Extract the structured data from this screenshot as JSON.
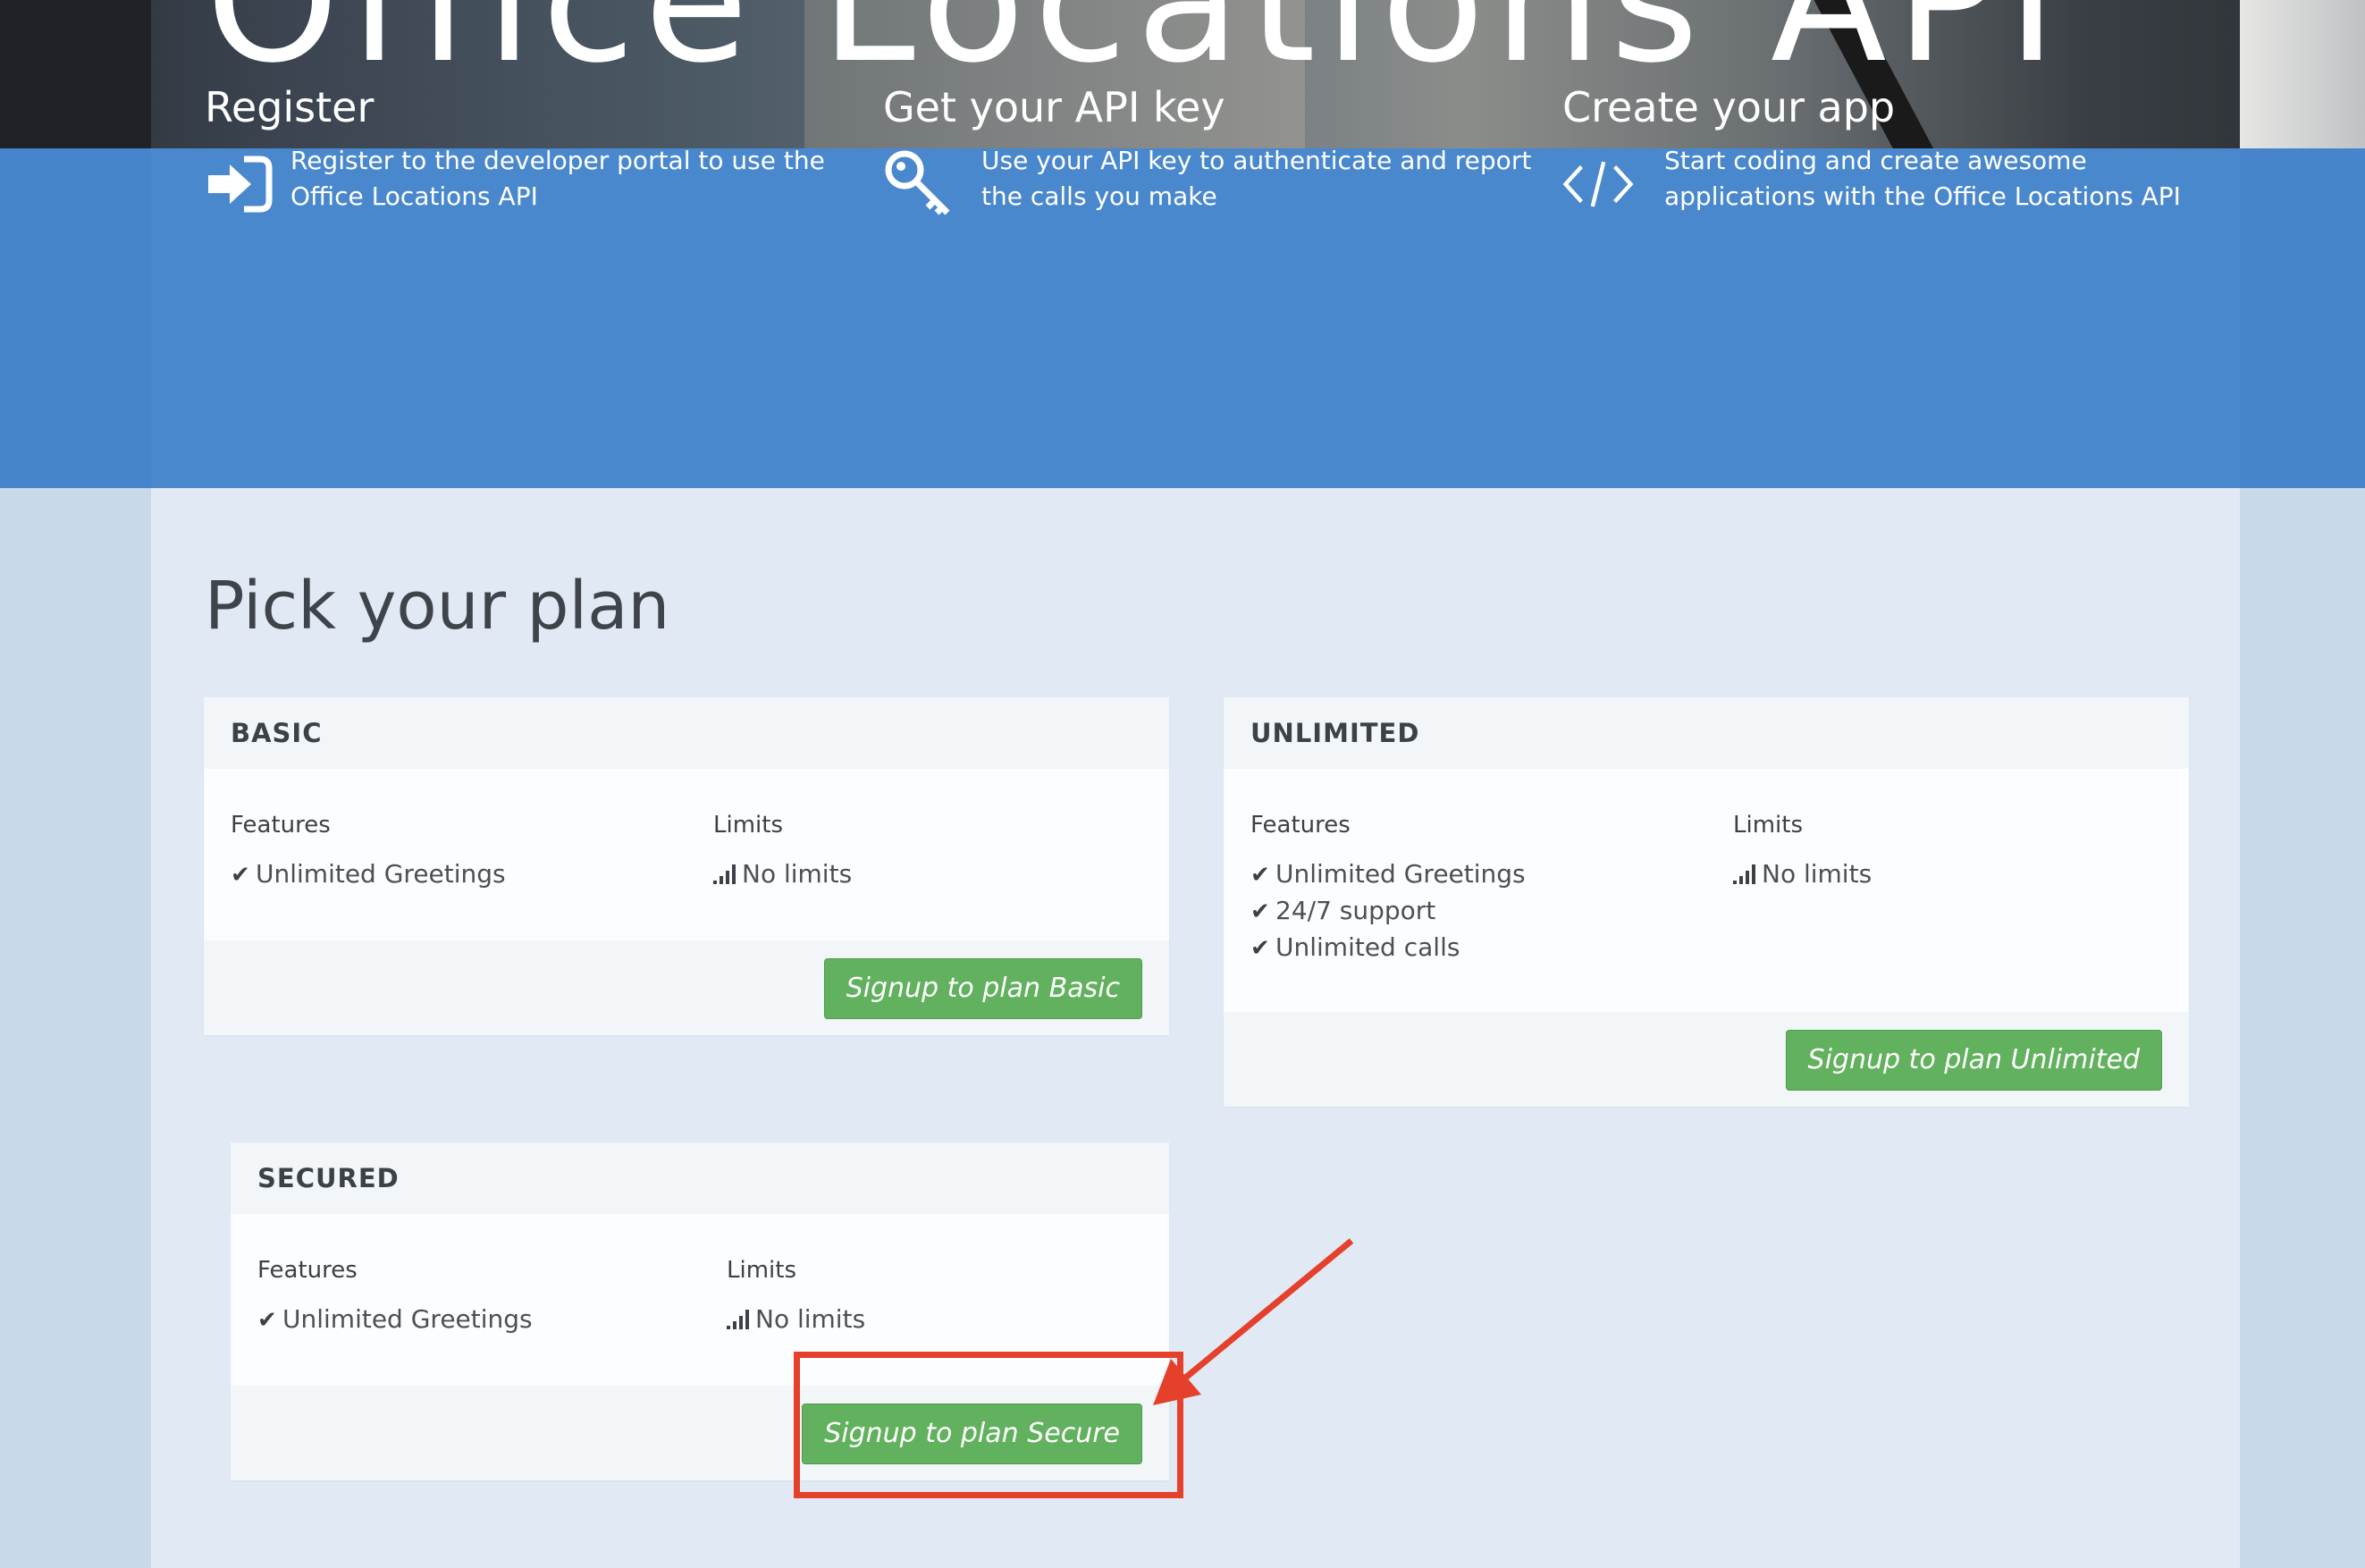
{
  "hero": {
    "title": "Office Locations API"
  },
  "steps": [
    {
      "title": "Register",
      "icon": "sign-in-icon",
      "text": "Register to the developer portal to use the Office Locations API"
    },
    {
      "title": "Get your API key",
      "icon": "key-icon",
      "text": "Use your API key to authenticate and report the calls you make"
    },
    {
      "title": "Create your app",
      "icon": "code-icon",
      "text": "Start coding and create awesome applications with the Office Locations API"
    }
  ],
  "page_title": "Pick your plan",
  "labels": {
    "features": "Features",
    "limits": "Limits"
  },
  "plans": {
    "basic": {
      "name": "BASIC",
      "features": [
        "Unlimited Greetings"
      ],
      "limit": "No limits",
      "button": "Signup to plan Basic"
    },
    "unlimited": {
      "name": "UNLIMITED",
      "features": [
        "Unlimited Greetings",
        "24/7 support",
        "Unlimited calls"
      ],
      "limit": "No limits",
      "button": "Signup to plan Unlimited"
    },
    "secured": {
      "name": "SECURED",
      "features": [
        "Unlimited Greetings"
      ],
      "limit": "No limits",
      "button": "Signup to plan Secure"
    }
  },
  "colors": {
    "hero_blue": "#4a88ce",
    "content_bg": "#e1eaf4",
    "button_green": "#62b15e",
    "annotation_red": "#e5402b"
  }
}
